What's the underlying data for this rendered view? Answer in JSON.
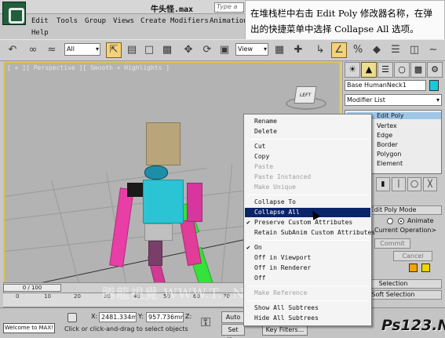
{
  "window": {
    "title": "牛头怪.max",
    "search_placeholder": "Type a keyword..."
  },
  "menu": {
    "items": [
      "Edit",
      "Tools",
      "Group",
      "Views",
      "Create",
      "Modifiers",
      "Animation",
      "Help"
    ]
  },
  "callout": {
    "text": "在堆栈栏中右击 Edit Poly 修改器名称，在弹出的快捷菜单中选择 Collapse All 选项。"
  },
  "toolbar": {
    "selection_filter": "All",
    "reference_coord": "View",
    "icons": [
      "undo-icon",
      "link-icon",
      "unlink-icon",
      "bind-spacewarp-icon",
      "select-icon",
      "select-by-name-icon",
      "rect-region-icon",
      "window-crossing-icon",
      "move-icon",
      "rotate-icon",
      "scale-icon",
      "pivot-icon",
      "snap-icon",
      "angle-snap-icon",
      "percent-snap-icon",
      "mirror-icon",
      "align-icon",
      "layer-icon",
      "curve-editor-icon",
      "schematic-icon"
    ]
  },
  "viewport": {
    "label": "[ + ][ Perspective ][ Smooth + Highlights ]",
    "view_cube_label": "LEFT"
  },
  "command_panel": {
    "object_name": "Base HumanNeck1",
    "object_color": "#18c9d9",
    "modifier_list": "Modifier List",
    "stack": [
      "Edit Poly",
      "Vertex",
      "Edge",
      "Border",
      "Polygon",
      "Element"
    ],
    "rollout_mode": "Edit Poly Mode",
    "radio_animate": "Animate",
    "current_operation": "Current Operation>",
    "commit": "Commit",
    "cancel": "Cancel",
    "selection_rollout": "Selection",
    "soft_selection_rollout": "Soft Selection"
  },
  "context_menu": {
    "items": [
      {
        "label": "Rename",
        "disabled": false
      },
      {
        "label": "Delete",
        "disabled": false
      },
      {
        "label": "Cut",
        "disabled": false
      },
      {
        "label": "Copy",
        "disabled": false
      },
      {
        "label": "Paste",
        "disabled": true
      },
      {
        "label": "Paste Instanced",
        "disabled": true
      },
      {
        "label": "Make Unique",
        "disabled": true
      },
      {
        "label": "Collapse To",
        "disabled": false
      },
      {
        "label": "Collapse All",
        "disabled": false,
        "highlighted": true
      },
      {
        "label": "Preserve Custom Attributes",
        "disabled": false,
        "checked": true
      },
      {
        "label": "Retain SubAnim Custom Attributes",
        "disabled": false
      },
      {
        "label": "On",
        "disabled": false,
        "checked": true
      },
      {
        "label": "Off in Viewport",
        "disabled": false
      },
      {
        "label": "Off in Renderer",
        "disabled": false
      },
      {
        "label": "Off",
        "disabled": false
      },
      {
        "label": "Make Reference",
        "disabled": true
      },
      {
        "label": "Show All Subtrees",
        "disabled": false
      },
      {
        "label": "Hide All Subtrees",
        "disabled": false
      }
    ]
  },
  "timeline": {
    "frame_readout": "0 / 100",
    "tick_labels": [
      "0",
      "10",
      "20",
      "30",
      "40",
      "50",
      "60",
      "70"
    ]
  },
  "statusbar": {
    "maxscript": "Welcome to MAX!",
    "prompt": "Click or click-and-drag to select objects",
    "x_label": "X:",
    "x_value": "2481.334m",
    "y_label": "Y:",
    "y_value": "957.736mm",
    "z_label": "Z:",
    "auto_key": "Auto Ke",
    "set_key": "Set Key",
    "key_filters": "Key Filters..."
  },
  "watermark": {
    "text": "腾龍視覺 WWW.T...NET",
    "site_logo": "Ps123.Net"
  }
}
